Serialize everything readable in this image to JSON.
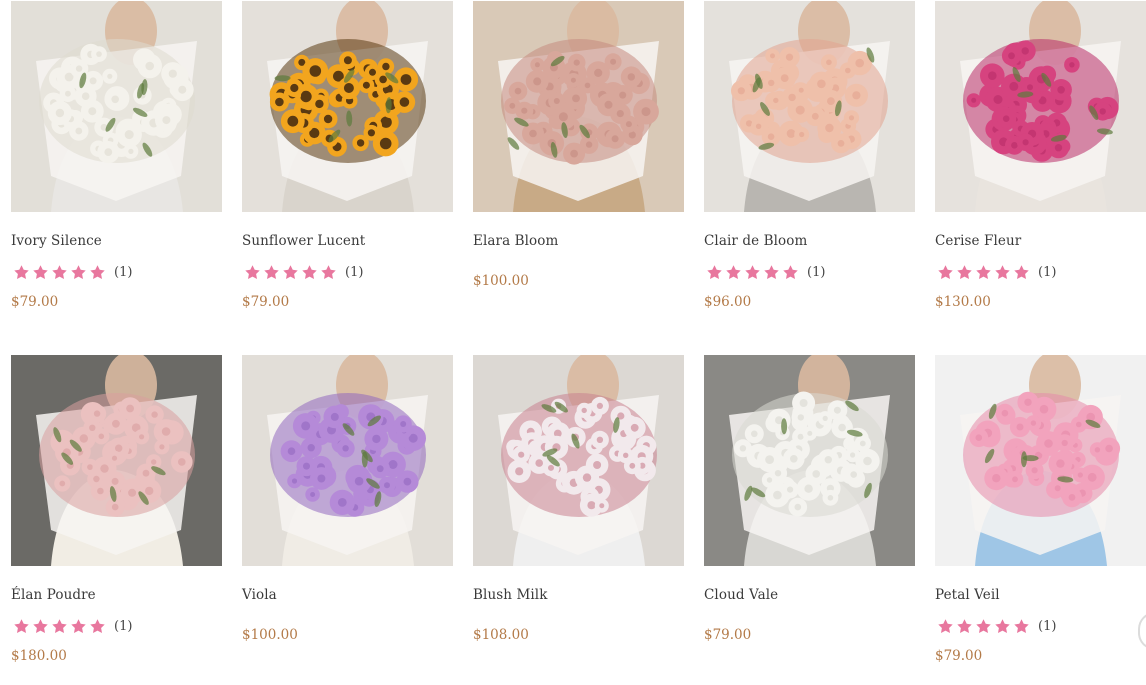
{
  "colors": {
    "star": "#e8779e",
    "price": "#b37a48",
    "text": "#3a3a3a"
  },
  "products": [
    {
      "name": "Ivory Silence",
      "price": "$79.00",
      "rating_count": "(1)",
      "stars": 5,
      "image": "white-tulip-bouquet",
      "flower": "#f4f2ec",
      "accent": "#dedad0",
      "bg": "#e2dfd8",
      "wear": "#e8e6e3"
    },
    {
      "name": "Sunflower Lucent",
      "price": "$79.00",
      "rating_count": "(1)",
      "stars": 5,
      "image": "sunflower-bouquet",
      "flower": "#f2a51e",
      "accent": "#5a3a12",
      "bg": "#e4e0da",
      "wear": "#d9d4cc"
    },
    {
      "name": "Elara Bloom",
      "price": "$100.00",
      "rating_count": "",
      "stars": 0,
      "image": "dusty-pink-rose-bouquet",
      "flower": "#d8a79b",
      "accent": "#c48b80",
      "bg": "#d9c9b7",
      "wear": "#c8aa86"
    },
    {
      "name": "Clair de Bloom",
      "price": "$96.00",
      "rating_count": "(1)",
      "stars": 5,
      "image": "peach-spray-rose-bouquet",
      "flower": "#efc0aa",
      "accent": "#e2a48f",
      "bg": "#e4e1dc",
      "wear": "#b9b6b1"
    },
    {
      "name": "Cerise Fleur",
      "price": "$130.00",
      "rating_count": "(1)",
      "stars": 5,
      "image": "magenta-rose-bouquet",
      "flower": "#d6437f",
      "accent": "#b82d67",
      "bg": "#e6e2dd",
      "wear": "#e9e4de"
    },
    {
      "name": "Élan Poudre",
      "price": "$180.00",
      "rating_count": "(1)",
      "stars": 5,
      "image": "blush-spray-rose-bouquet",
      "flower": "#ebc1c0",
      "accent": "#d89e9e",
      "bg": "#6b6a66",
      "wear": "#f1ede4"
    },
    {
      "name": "Viola",
      "price": "$100.00",
      "rating_count": "",
      "stars": 0,
      "image": "lilac-carnation-bouquet",
      "flower": "#b58ad8",
      "accent": "#9268c0",
      "bg": "#e2ded8",
      "wear": "#f0ece5"
    },
    {
      "name": "Blush Milk",
      "price": "$108.00",
      "rating_count": "",
      "stars": 0,
      "image": "lisianthus-bouquet",
      "flower": "#f2e9ec",
      "accent": "#c8818f",
      "bg": "#dcd8d3",
      "wear": "#efefef"
    },
    {
      "name": "Cloud Vale",
      "price": "$79.00",
      "rating_count": "",
      "stars": 0,
      "image": "white-carnation-bouquet",
      "flower": "#f4f3ef",
      "accent": "#d9d8d1",
      "bg": "#8a8985",
      "wear": "#d8d7d3"
    },
    {
      "name": "Petal Veil",
      "price": "$79.00",
      "rating_count": "(1)",
      "stars": 5,
      "image": "pink-tulip-bouquet",
      "flower": "#f2a3bd",
      "accent": "#e68aa9",
      "bg": "#f1f1f1",
      "wear": "#9fc6e6"
    }
  ]
}
